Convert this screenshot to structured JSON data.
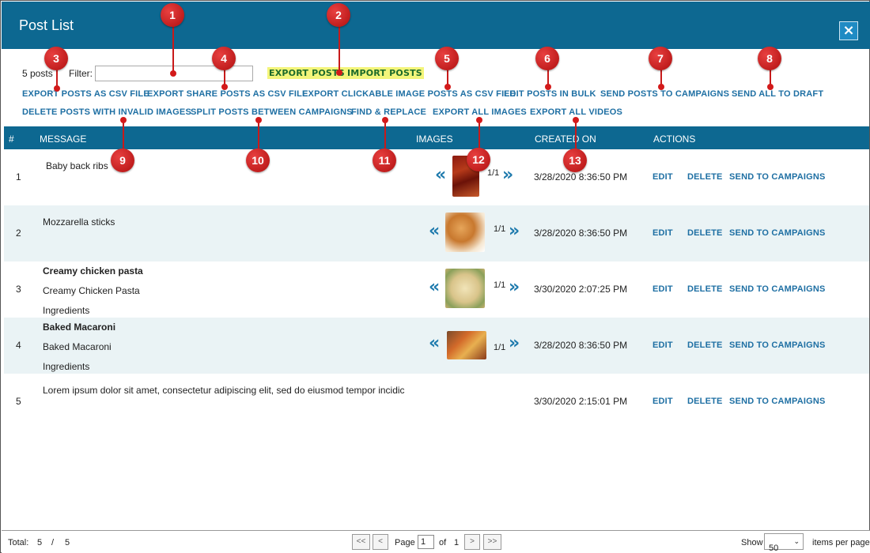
{
  "window": {
    "title": "Post List",
    "close_icon": "×"
  },
  "toolbar": {
    "count": "5 posts",
    "filter_label": "Filter:",
    "filter_value": "",
    "export_posts": "EXPORT POSTS",
    "import_posts": "IMPORT POSTS",
    "actions_row1": [
      "EXPORT POSTS AS CSV FILE",
      "EXPORT SHARE POSTS AS CSV FILE",
      "EXPORT CLICKABLE IMAGE POSTS AS CSV FILE",
      "EDIT POSTS IN BULK",
      "SEND POSTS TO CAMPAIGNS",
      "SEND ALL TO DRAFT"
    ],
    "actions_row2": [
      "DELETE POSTS WITH INVALID IMAGES",
      "SPLIT POSTS BETWEEN CAMPAIGNS",
      "FIND & REPLACE",
      "EXPORT ALL IMAGES",
      "EXPORT ALL VIDEOS"
    ]
  },
  "grid": {
    "columns": [
      "#",
      "MESSAGE",
      "IMAGES",
      "CREATED ON",
      "ACTIONS"
    ],
    "row_actions": [
      "EDIT",
      "DELETE",
      "SEND TO CAMPAIGNS"
    ],
    "rows": [
      {
        "num": "1",
        "lines": [
          "Baby back ribs"
        ],
        "bold_first": false,
        "pager": "1/1",
        "has_image": true,
        "date": "3/28/2020 8:36:50 PM"
      },
      {
        "num": "2",
        "lines": [
          "Mozzarella sticks"
        ],
        "bold_first": false,
        "pager": "1/1",
        "has_image": true,
        "date": "3/28/2020 8:36:50 PM"
      },
      {
        "num": "3",
        "lines": [
          "Creamy chicken pasta",
          "Creamy Chicken Pasta",
          "Ingredients"
        ],
        "bold_first": true,
        "pager": "1/1",
        "has_image": true,
        "date": "3/30/2020 2:07:25 PM"
      },
      {
        "num": "4",
        "lines": [
          "Baked Macaroni",
          "Baked Macaroni",
          "Ingredients"
        ],
        "bold_first": true,
        "pager": "1/1",
        "has_image": true,
        "date": "3/28/2020 8:36:50 PM"
      },
      {
        "num": "5",
        "lines": [
          "Lorem ipsum dolor sit amet, consectetur adipiscing elit, sed do eiusmod tempor incidic"
        ],
        "bold_first": false,
        "pager": "",
        "has_image": false,
        "date": "3/30/2020 2:15:01 PM"
      }
    ]
  },
  "icons": {
    "prev_arrow": "«",
    "next_arrow": "»"
  },
  "callouts": [
    "1",
    "2",
    "3",
    "4",
    "5",
    "6",
    "7",
    "8",
    "9",
    "10",
    "11",
    "12",
    "13"
  ],
  "footer": {
    "total_label": "Total:",
    "total_shown": "5",
    "separator": "/",
    "total_all": "5",
    "first_btn": "<<",
    "prev_btn": "<",
    "page_label": "Page",
    "page_value": "1",
    "of_label": "of",
    "page_count": "1",
    "next_btn": ">",
    "last_btn": ">>",
    "show_label": "Show",
    "page_size": "50",
    "items_label": "items per page"
  },
  "colors": {
    "header_bg": "#0d6891",
    "link": "#1e6fa3",
    "highlight": "#f3f57a",
    "callout": "#c81a1a",
    "alt_row": "#eaf3f5"
  }
}
